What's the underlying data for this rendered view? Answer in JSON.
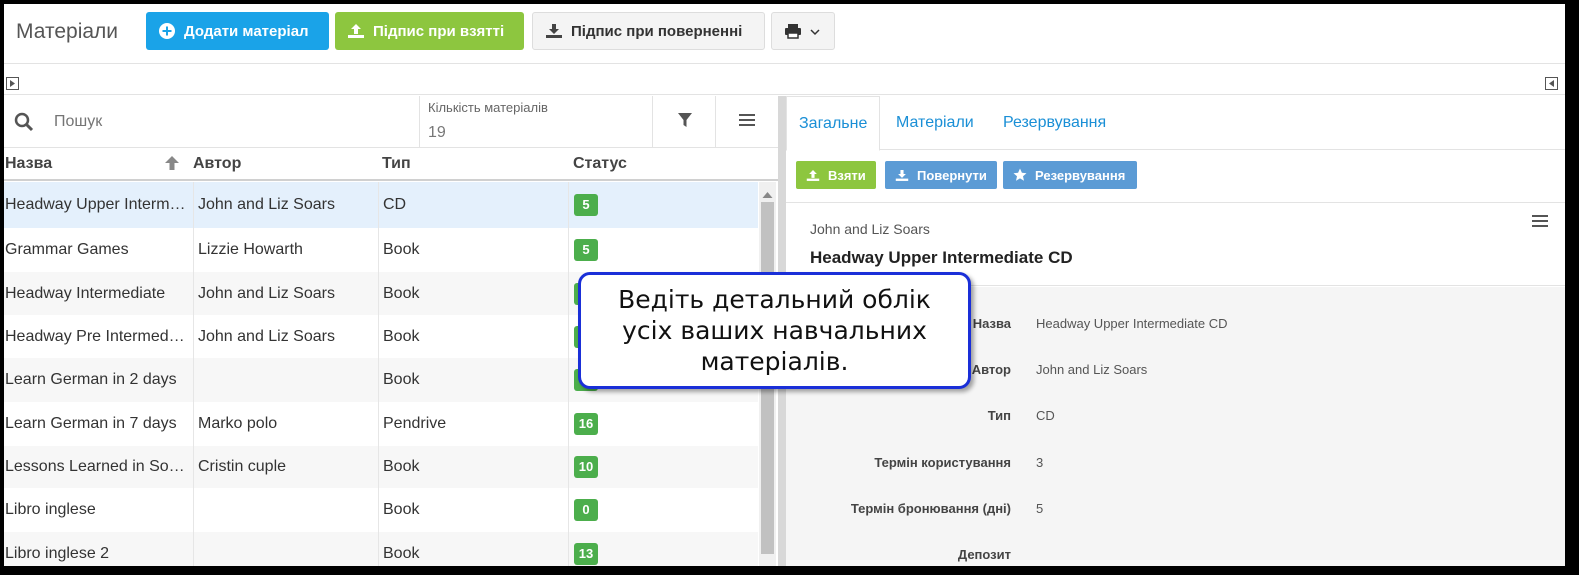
{
  "toolbar": {
    "title": "Матеріали",
    "add_label": "Додати матеріал",
    "take_label": "Підпис при взятті",
    "return_label": "Підпис при поверненні",
    "add_icon": "plus-circle-icon",
    "take_icon": "upload-icon",
    "return_icon": "download-icon",
    "print_icon": "printer-icon"
  },
  "list": {
    "search_placeholder": "Пошук",
    "count_label": "Кількість матеріалів",
    "count_value": "19",
    "columns": [
      "Назва",
      "Автор",
      "Тип",
      "Статус"
    ],
    "rows": [
      {
        "name": "Headway Upper Intermediate CD",
        "author": "John and Liz Soars",
        "type": "CD",
        "status": "5"
      },
      {
        "name": "Grammar Games",
        "author": "Lizzie Howarth",
        "type": "Book",
        "status": "5"
      },
      {
        "name": "Headway Intermediate",
        "author": "John and Liz Soars",
        "type": "Book",
        "status": "5"
      },
      {
        "name": "Headway Pre Intermediate",
        "author": "John and Liz Soars",
        "type": "Book",
        "status": "5"
      },
      {
        "name": "Learn German in 2 days",
        "author": "",
        "type": "Book",
        "status": "5"
      },
      {
        "name": "Learn German in 7 days",
        "author": "Marko polo",
        "type": "Pendrive",
        "status": "16"
      },
      {
        "name": "Lessons Learned in Software Testing",
        "author": "Cristin cuple",
        "type": "Book",
        "status": "10"
      },
      {
        "name": "Libro inglese",
        "author": "",
        "type": "Book",
        "status": "0"
      },
      {
        "name": "Libro inglese 2",
        "author": "",
        "type": "Book",
        "status": "13"
      }
    ]
  },
  "detail": {
    "tabs": [
      "Загальне",
      "Матеріали",
      "Резервування"
    ],
    "actions": {
      "take": "Взяти",
      "return": "Повернути",
      "reserve": "Резервування"
    },
    "author": "John and Liz Soars",
    "title": "Headway Upper Intermediate CD",
    "fields": [
      {
        "label": "Назва",
        "value": "Headway Upper Intermediate CD"
      },
      {
        "label": "Автор",
        "value": "John and Liz Soars"
      },
      {
        "label": "Тип",
        "value": "CD"
      },
      {
        "label": "Термін користування",
        "value": "3"
      },
      {
        "label": "Термін бронювання (дні)",
        "value": "5"
      },
      {
        "label": "Депозит",
        "value": ""
      }
    ]
  },
  "callout": {
    "text": "Ведіть детальний облік усіх ваших навчальних матеріалів."
  },
  "colors": {
    "accent_blue": "#1aa3e8",
    "accent_green": "#8dc63f",
    "status_green": "#4cae4c",
    "callout_border": "#1a2fd8"
  }
}
